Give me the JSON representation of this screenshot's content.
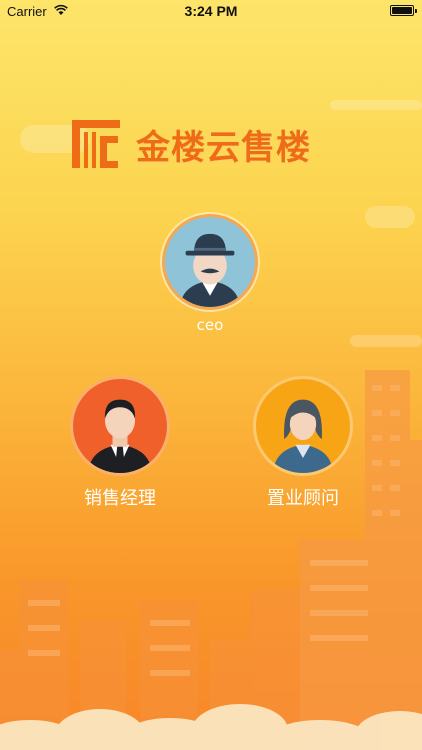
{
  "status_bar": {
    "carrier": "Carrier",
    "time": "3:24 PM"
  },
  "app": {
    "logo_text": "金楼云售楼"
  },
  "roles": [
    {
      "label": "ceo"
    },
    {
      "label": "销售经理"
    },
    {
      "label": "置业顾问"
    }
  ]
}
